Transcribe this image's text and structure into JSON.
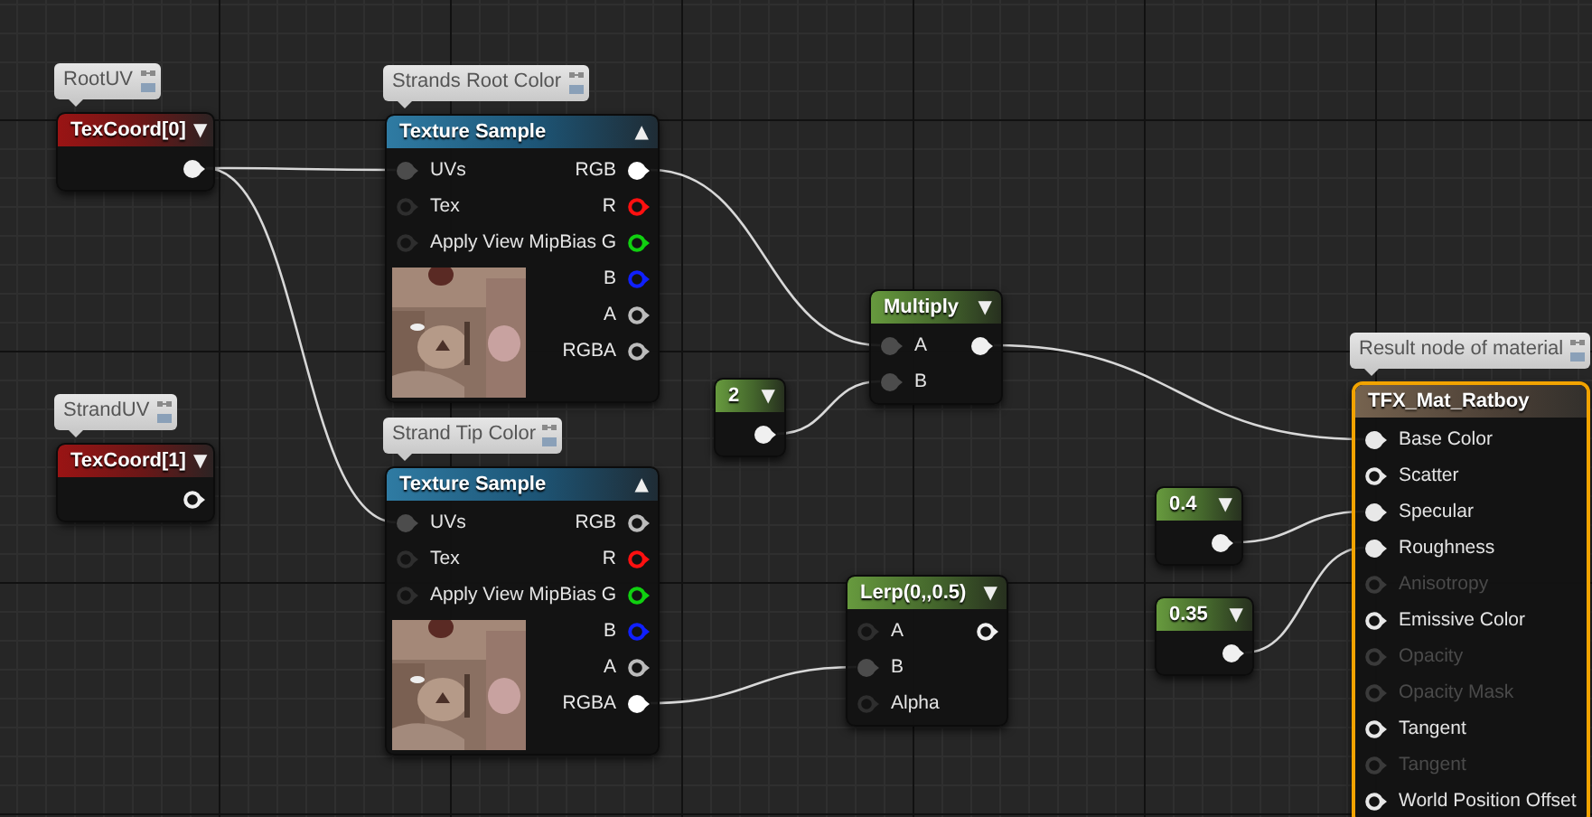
{
  "nodes": [
    {
      "kind": "texcoord",
      "comment": "RootUV",
      "title": "TexCoord[0]",
      "glyph": "▼",
      "outputs": [
        {
          "connected": true
        }
      ]
    },
    {
      "kind": "texture",
      "comment": "Strands Root Color",
      "title": "Texture Sample",
      "glyph": "▲",
      "inputs": [
        {
          "label": "UVs",
          "connected": true
        },
        {
          "label": "Tex",
          "connected": false
        },
        {
          "label": "Apply View MipBias",
          "connected": false
        }
      ],
      "outputs": [
        {
          "label": "RGB",
          "connected": true,
          "color": "#ffffff"
        },
        {
          "label": "R",
          "connected": false,
          "color": "#ff1010"
        },
        {
          "label": "G",
          "connected": false,
          "color": "#10d010"
        },
        {
          "label": "B",
          "connected": false,
          "color": "#1020ff"
        },
        {
          "label": "A",
          "connected": false,
          "color": "#bbbbbb"
        },
        {
          "label": "RGBA",
          "connected": false,
          "color": "#bbbbbb"
        }
      ]
    },
    {
      "kind": "texcoord",
      "comment": "StrandUV",
      "title": "TexCoord[1]",
      "glyph": "▼",
      "outputs": [
        {
          "connected": false
        }
      ]
    },
    {
      "kind": "texture",
      "comment": "Strand Tip Color",
      "title": "Texture Sample",
      "glyph": "▲",
      "inputs": [
        {
          "label": "UVs",
          "connected": true
        },
        {
          "label": "Tex",
          "connected": false
        },
        {
          "label": "Apply View MipBias",
          "connected": false
        }
      ],
      "outputs": [
        {
          "label": "RGB",
          "connected": false,
          "color": "#bbbbbb"
        },
        {
          "label": "R",
          "connected": false,
          "color": "#ff1010"
        },
        {
          "label": "G",
          "connected": false,
          "color": "#10d010"
        },
        {
          "label": "B",
          "connected": false,
          "color": "#1020ff"
        },
        {
          "label": "A",
          "connected": false,
          "color": "#bbbbbb"
        },
        {
          "label": "RGBA",
          "connected": true,
          "color": "#ffffff"
        }
      ]
    },
    {
      "kind": "math",
      "title": "Multiply",
      "glyph": "▼",
      "inputs": [
        {
          "label": "A",
          "connected": true
        },
        {
          "label": "B",
          "connected": true
        }
      ],
      "outputs": [
        {
          "connected": true
        }
      ]
    },
    {
      "kind": "constant",
      "title": "2",
      "glyph": "▼",
      "outputs": [
        {
          "connected": true
        }
      ]
    },
    {
      "kind": "math",
      "title": "Lerp(0,,0.5)",
      "glyph": "▼",
      "inputs": [
        {
          "label": "A",
          "connected": false
        },
        {
          "label": "B",
          "connected": true
        },
        {
          "label": "Alpha",
          "connected": false
        }
      ],
      "outputs": [
        {
          "connected": false
        }
      ]
    },
    {
      "kind": "constant",
      "title": "0.4",
      "glyph": "▼",
      "outputs": [
        {
          "connected": true
        }
      ]
    },
    {
      "kind": "constant",
      "title": "0.35",
      "glyph": "▼",
      "outputs": [
        {
          "connected": true
        }
      ]
    },
    {
      "kind": "result",
      "comment": "Result node of material",
      "title": "TFX_Mat_Ratboy",
      "inputs": [
        {
          "label": "Base Color",
          "connected": true,
          "disabled": false
        },
        {
          "label": "Scatter",
          "connected": false,
          "disabled": false
        },
        {
          "label": "Specular",
          "connected": true,
          "disabled": false
        },
        {
          "label": "Roughness",
          "connected": true,
          "disabled": false
        },
        {
          "label": "Anisotropy",
          "connected": false,
          "disabled": true
        },
        {
          "label": "Emissive Color",
          "connected": false,
          "disabled": false
        },
        {
          "label": "Opacity",
          "connected": false,
          "disabled": true
        },
        {
          "label": "Opacity Mask",
          "connected": false,
          "disabled": true
        },
        {
          "label": "Tangent",
          "connected": false,
          "disabled": false
        },
        {
          "label": "Tangent",
          "connected": false,
          "disabled": true
        },
        {
          "label": "World Position Offset",
          "connected": false,
          "disabled": false
        }
      ]
    }
  ]
}
